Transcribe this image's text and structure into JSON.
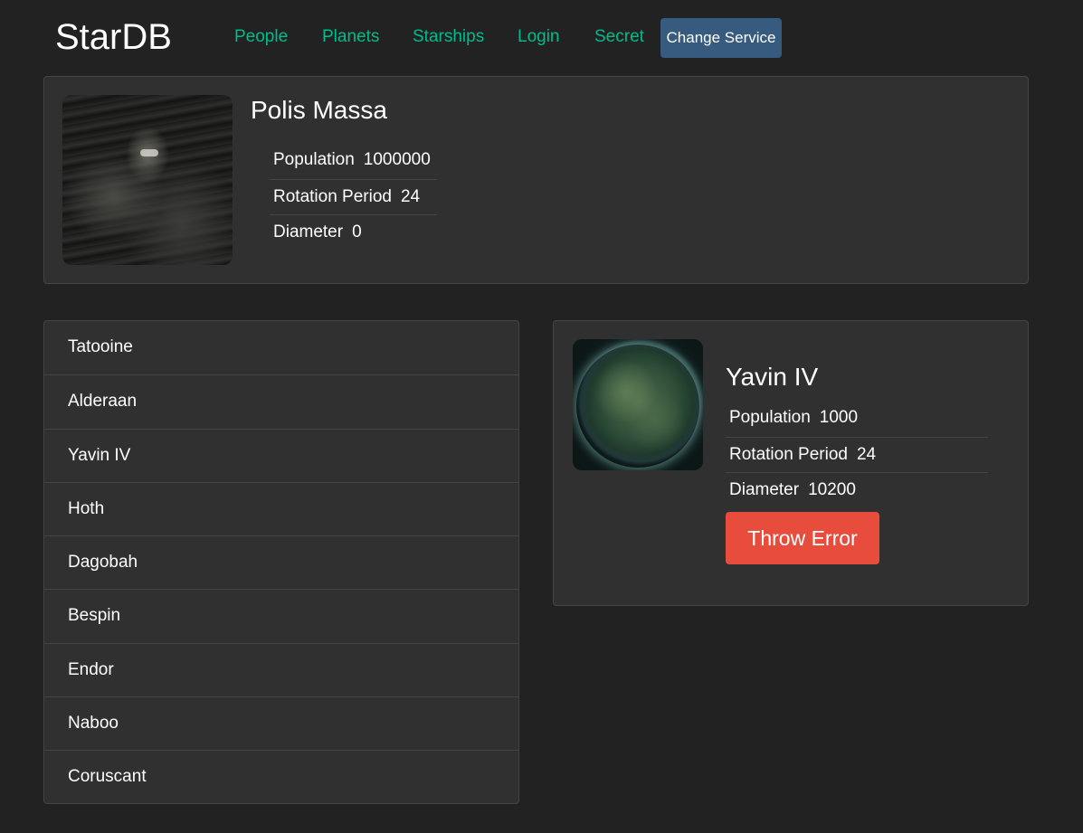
{
  "header": {
    "brand": "StarDB",
    "nav": [
      "People",
      "Planets",
      "Starships",
      "Login",
      "Secret"
    ],
    "change_service": "Change Service"
  },
  "random_planet": {
    "name": "Polis Massa",
    "details": [
      {
        "term": "Population",
        "value": "1000000"
      },
      {
        "term": "Rotation Period",
        "value": "24"
      },
      {
        "term": "Diameter",
        "value": "0"
      }
    ]
  },
  "planet_list": [
    "Tatooine",
    "Alderaan",
    "Yavin IV",
    "Hoth",
    "Dagobah",
    "Bespin",
    "Endor",
    "Naboo",
    "Coruscant"
  ],
  "selected_planet": {
    "name": "Yavin IV",
    "details": [
      {
        "term": "Population",
        "value": "1000"
      },
      {
        "term": "Rotation Period",
        "value": "24"
      },
      {
        "term": "Diameter",
        "value": "10200"
      }
    ],
    "error_button": "Throw Error"
  },
  "colors": {
    "background": "#222222",
    "card": "#303030",
    "nav_link": "#00bc8c",
    "primary_button": "#375a7f",
    "danger_button": "#e74c3c"
  }
}
